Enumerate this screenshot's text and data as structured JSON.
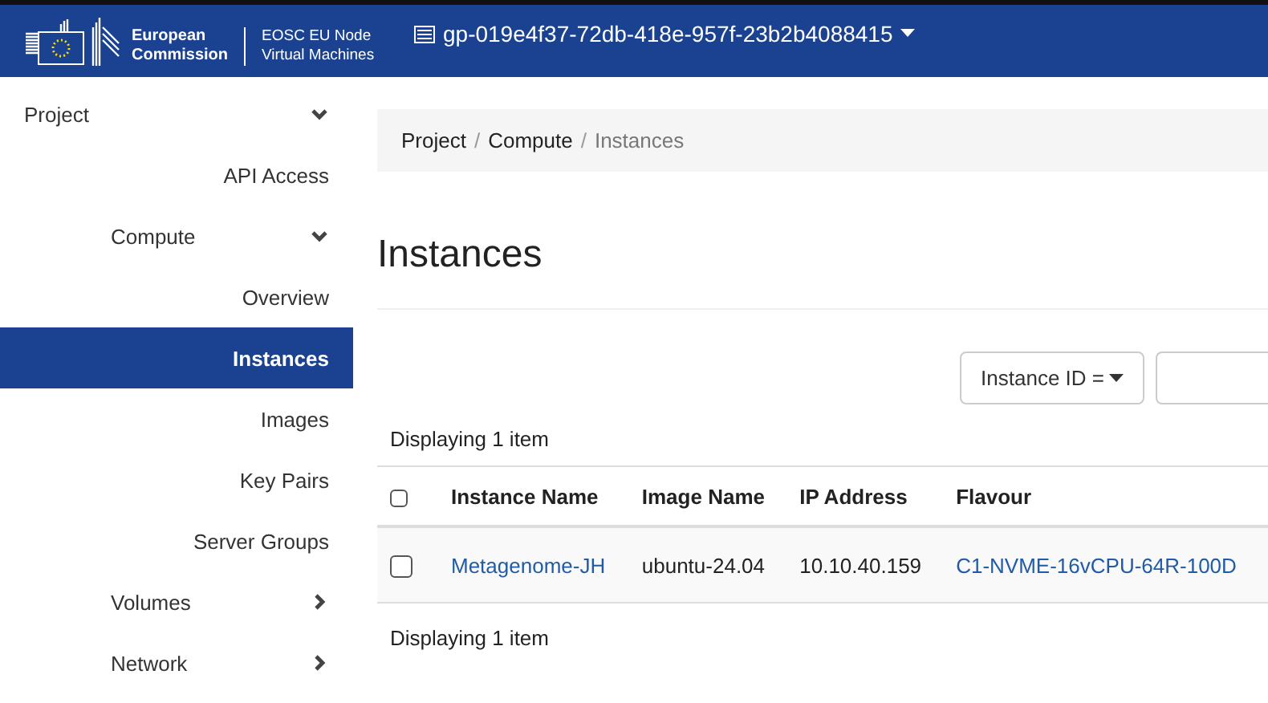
{
  "header": {
    "brand": {
      "org_line_1": "European",
      "org_line_2": "Commission",
      "app_line_1": "EOSC EU Node",
      "app_line_2": "Virtual Machines"
    },
    "project_selector": "gp-019e4f37-72db-418e-957f-23b2b4088415"
  },
  "sidebar": {
    "items": [
      {
        "label": "Project",
        "kind": "section",
        "expanded": true,
        "children": [
          {
            "label": "API Access",
            "kind": "link",
            "selected": false
          },
          {
            "label": "Compute",
            "kind": "section",
            "expanded": true,
            "children": [
              {
                "label": "Overview",
                "kind": "link",
                "selected": false
              },
              {
                "label": "Instances",
                "kind": "link",
                "selected": true
              },
              {
                "label": "Images",
                "kind": "link",
                "selected": false
              },
              {
                "label": "Key Pairs",
                "kind": "link",
                "selected": false
              },
              {
                "label": "Server Groups",
                "kind": "link",
                "selected": false
              }
            ]
          },
          {
            "label": "Volumes",
            "kind": "section",
            "expanded": false
          },
          {
            "label": "Network",
            "kind": "section",
            "expanded": false
          }
        ]
      }
    ]
  },
  "breadcrumb": [
    {
      "label": "Project",
      "current": false
    },
    {
      "separator": "/",
      "label": "Compute",
      "current": false
    },
    {
      "separator": "/",
      "label": "Instances",
      "current": true
    }
  ],
  "page_title": "Instances",
  "filter": {
    "field_button": "Instance ID ="
  },
  "count_top": "Displaying 1 item",
  "table": {
    "columns": [
      "Instance Name",
      "Image Name",
      "IP Address",
      "Flavour"
    ],
    "header_checked": false,
    "rows": [
      {
        "checked": false,
        "cells": [
          {
            "text": "Metagenome-JH",
            "link": true
          },
          {
            "text": "ubuntu-24.04",
            "link": false
          },
          {
            "text": "10.10.40.159",
            "link": false
          },
          {
            "text": "C1-NVME-16vCPU-64R-100D",
            "link": true
          }
        ]
      }
    ]
  },
  "count_bottom": "Displaying 1 item"
}
